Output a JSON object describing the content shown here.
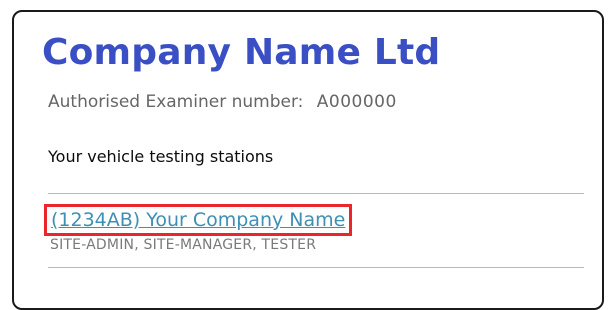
{
  "company": {
    "name": "Company Name Ltd"
  },
  "examiner": {
    "label": "Authorised Examiner number:",
    "value": "A000000"
  },
  "stations": {
    "heading": "Your vehicle testing stations",
    "items": [
      {
        "link_text": "(1234AB) Your Company Name",
        "roles": "SITE-ADMIN, SITE-MANAGER, TESTER",
        "highlighted": true
      }
    ]
  },
  "colors": {
    "title": "#3b4fc4",
    "link": "#3e8fb4",
    "highlight_border": "#e8262c",
    "card_border": "#1a1a1a",
    "muted_text": "#666666"
  }
}
